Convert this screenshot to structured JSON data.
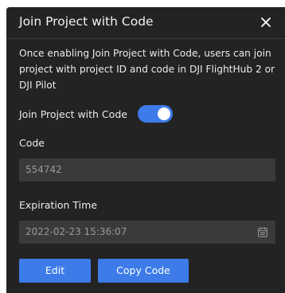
{
  "dialog": {
    "title": "Join Project with Code",
    "description": "Once enabling Join Project with Code, users can join project with project ID and code in DJI FlightHub 2 or DJI Pilot",
    "close_icon": "close-icon"
  },
  "toggle": {
    "label": "Join Project with Code",
    "enabled": true
  },
  "code": {
    "label": "Code",
    "value": "554742"
  },
  "expiration": {
    "label": "Expiration Time",
    "value": "2022-02-23 15:36:07",
    "icon": "calendar-icon"
  },
  "buttons": {
    "edit_label": "Edit",
    "copy_label": "Copy Code"
  },
  "colors": {
    "panel_bg": "#232323",
    "accent": "#3c7be8",
    "field_bg": "#3a3a3a",
    "text": "#ebebeb",
    "muted_text": "#9a9a9a"
  }
}
